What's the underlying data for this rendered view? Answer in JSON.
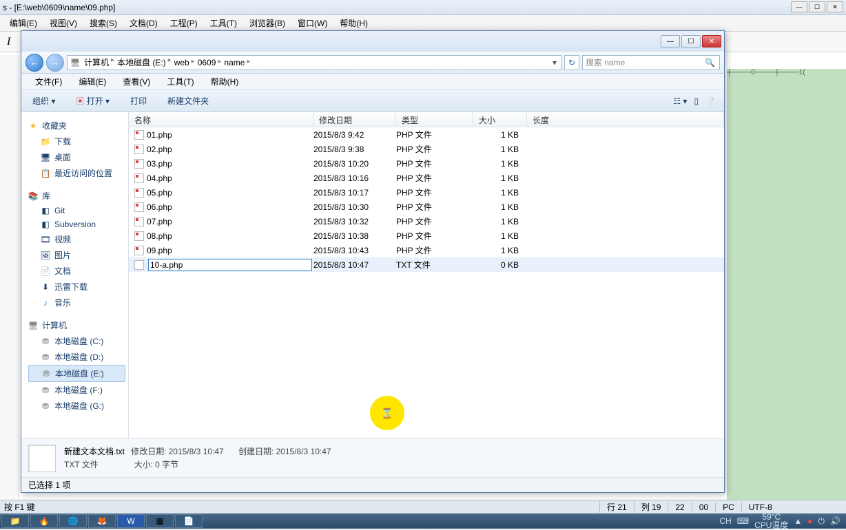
{
  "editor": {
    "title": "s - [E:\\web\\0609\\name\\09.php]",
    "menus": [
      "编辑(E)",
      "视图(V)",
      "搜索(S)",
      "文档(D)",
      "工程(P)",
      "工具(T)",
      "浏览器(B)",
      "窗口(W)",
      "帮助(H)"
    ],
    "ruler": "┼────0────┼────1(",
    "status_hint": "按 F1 键",
    "status_cells": {
      "row": "行 21",
      "col": "列 19",
      "sel": "22",
      "len": "00",
      "mode": "PC",
      "enc": "UTF-8"
    }
  },
  "explorer": {
    "breadcrumb": [
      "计算机",
      "本地磁盘 (E:)",
      "web",
      "0609",
      "name"
    ],
    "search_placeholder": "搜索 name",
    "menus": [
      "文件(F)",
      "编辑(E)",
      "查看(V)",
      "工具(T)",
      "帮助(H)"
    ],
    "cmdbar": {
      "organize": "组织 ▾",
      "open": "打开 ▾",
      "print": "打印",
      "newfolder": "新建文件夹"
    },
    "nav": {
      "favorites": {
        "head": "收藏夹",
        "items": [
          "下载",
          "桌面",
          "最近访问的位置"
        ]
      },
      "libs": {
        "head": "库",
        "items": [
          "Git",
          "Subversion",
          "视频",
          "图片",
          "文档",
          "迅雷下载",
          "音乐"
        ]
      },
      "computer": {
        "head": "计算机",
        "items": [
          "本地磁盘 (C:)",
          "本地磁盘 (D:)",
          "本地磁盘 (E:)",
          "本地磁盘 (F:)",
          "本地磁盘 (G:)"
        ]
      }
    },
    "columns": {
      "name": "名称",
      "date": "修改日期",
      "type": "类型",
      "size": "大小",
      "len": "长度"
    },
    "files": [
      {
        "name": "01.php",
        "date": "2015/8/3 9:42",
        "type": "PHP 文件",
        "size": "1 KB"
      },
      {
        "name": "02.php",
        "date": "2015/8/3 9:38",
        "type": "PHP 文件",
        "size": "1 KB"
      },
      {
        "name": "03.php",
        "date": "2015/8/3 10:20",
        "type": "PHP 文件",
        "size": "1 KB"
      },
      {
        "name": "04.php",
        "date": "2015/8/3 10:16",
        "type": "PHP 文件",
        "size": "1 KB"
      },
      {
        "name": "05.php",
        "date": "2015/8/3 10:17",
        "type": "PHP 文件",
        "size": "1 KB"
      },
      {
        "name": "06.php",
        "date": "2015/8/3 10:30",
        "type": "PHP 文件",
        "size": "1 KB"
      },
      {
        "name": "07.php",
        "date": "2015/8/3 10:32",
        "type": "PHP 文件",
        "size": "1 KB"
      },
      {
        "name": "08.php",
        "date": "2015/8/3 10:38",
        "type": "PHP 文件",
        "size": "1 KB"
      },
      {
        "name": "09.php",
        "date": "2015/8/3 10:43",
        "type": "PHP 文件",
        "size": "1 KB"
      }
    ],
    "rename": {
      "value": "10-a.php",
      "date": "2015/8/3 10:47",
      "type": "TXT 文件",
      "size": "0 KB"
    },
    "details": {
      "filename": "新建文本文档.txt",
      "filetype": "TXT 文件",
      "mod_label": "修改日期:",
      "mod": "2015/8/3 10:47",
      "create_label": "创建日期:",
      "create": "2015/8/3 10:47",
      "size_label": "大小:",
      "size": "0 字节"
    },
    "status": "已选择 1 项"
  },
  "taskbar": {
    "temp": "59°C",
    "cpu": "CPU温度",
    "ime": "CH"
  }
}
